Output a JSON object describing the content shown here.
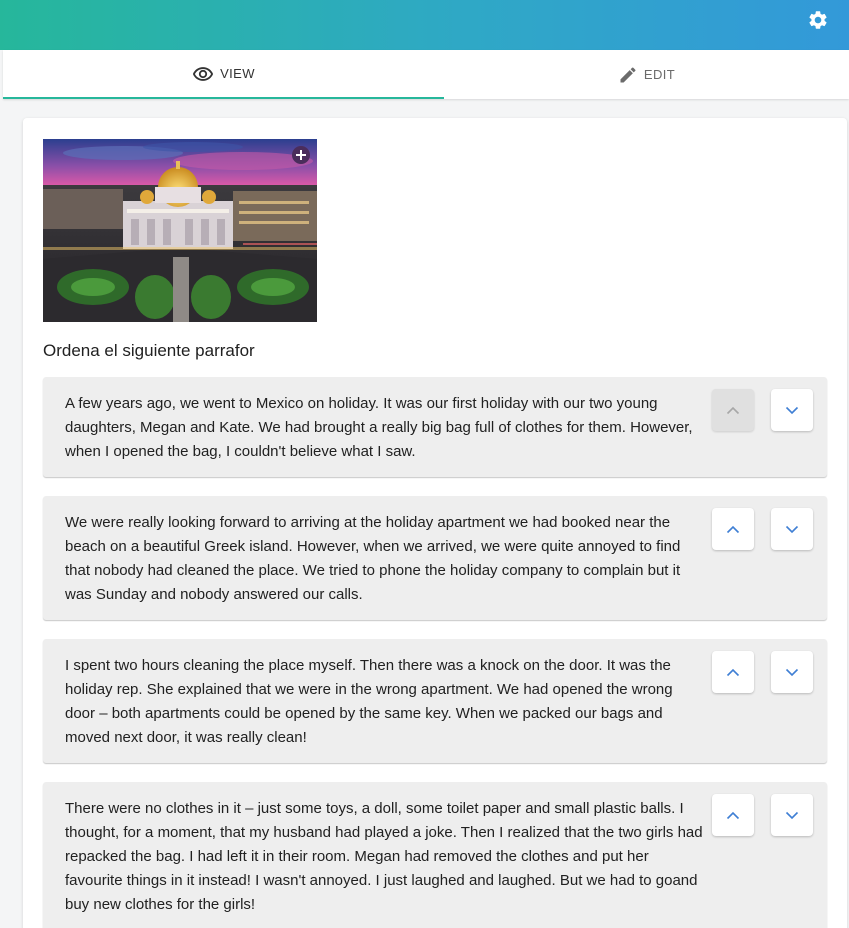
{
  "tabs": {
    "view_label": "VIEW",
    "edit_label": "EDIT"
  },
  "question": {
    "prompt": "Ordena el siguiente parrafor"
  },
  "items": [
    {
      "text": "A few years ago, we went to Mexico on holiday. It was our first holiday with our two young daughters, Megan and Kate. We had brought a really big bag full of clothes for them. However, when I opened the bag, I couldn't believe what I saw.",
      "up_disabled": true
    },
    {
      "text": "We were really looking forward to arriving at the holiday apartment we had booked near the beach on a beautiful Greek island. However, when we arrived, we were quite annoyed to find that nobody had cleaned the place. We tried to phone the holiday company to complain but it was Sunday and nobody answered our calls.",
      "up_disabled": false
    },
    {
      "text": "I spent two hours cleaning the place myself. Then there was a knock on the door. It was the holiday rep. She explained that we were in the wrong apartment. We had opened the wrong door – both apartments could be opened by the same key. When we packed our bags and moved next door, it was really clean!",
      "up_disabled": false
    },
    {
      "text": "There were no clothes in it – just some toys, a doll, some toilet paper and small plastic balls. I thought, for a moment, that my husband had played a joke. Then I realized that the two girls had repacked the bag. I had left it in their room. Megan had removed the clothes and put her favourite things in it instead! I wasn't annoyed. I just laughed and laughed. But we had to goand buy new clothes for the girls!",
      "up_disabled": false
    }
  ],
  "colors": {
    "accent": "#26b79b",
    "header_start": "#26b79b",
    "header_end": "#3399d9",
    "arrow": "#3f7fd4",
    "item_bg": "#eeeeee"
  },
  "icons": {
    "settings": "gear-icon",
    "view": "eye-icon",
    "edit": "pencil-icon",
    "zoom": "plus-circle-icon",
    "up": "chevron-up-icon",
    "down": "chevron-down-icon"
  }
}
